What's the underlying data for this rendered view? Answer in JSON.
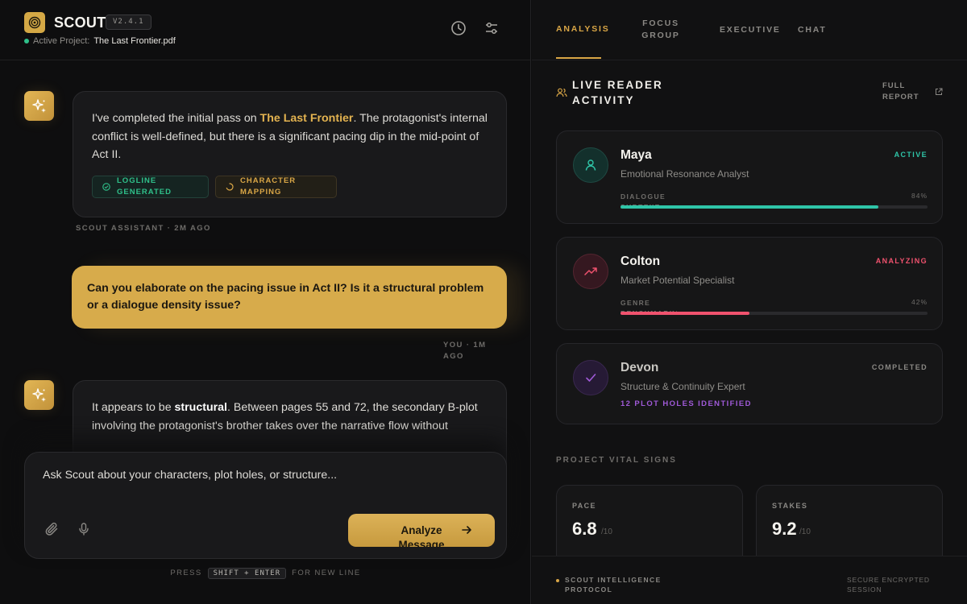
{
  "header": {
    "app_name": "SCOUT",
    "version": "V2.4.1",
    "project_label": "Active Project:",
    "project_name": "The Last Frontier.pdf",
    "icons": [
      "history-icon",
      "filter-icon"
    ]
  },
  "chat": {
    "messages": [
      {
        "role": "assistant",
        "text_before": "I've completed the initial pass on ",
        "highlight": "The Last Frontier",
        "text_after": ". The protagonist's internal conflict is well-defined, but there is a significant pacing dip in the mid-point of Act II.",
        "chips": [
          {
            "label": "LOGLINE GENERATED",
            "status": "done",
            "color": "#2fc08a"
          },
          {
            "label": "CHARACTER MAPPING",
            "status": "in-progress",
            "color": "#d9a646"
          }
        ],
        "meta": "SCOUT ASSISTANT · 2M AGO"
      },
      {
        "role": "user",
        "text": "Can you elaborate on the pacing issue in Act II? Is it a structural problem or a dialogue density issue?",
        "meta": "YOU · 1M AGO"
      },
      {
        "role": "assistant",
        "text_before": "It appears to be ",
        "bold": "structural",
        "text_after": ". Between pages 55 and 72, the secondary B-plot involving the protagonist's brother takes over the narrative flow without"
      }
    ]
  },
  "composer": {
    "placeholder": "Ask Scout about your characters, plot holes, or structure...",
    "analyze_label": "Analyze Message",
    "hint_before": "PRESS",
    "hint_key": "SHIFT + ENTER",
    "hint_after": "FOR NEW LINE"
  },
  "tabs": [
    {
      "label": "ANALYSIS",
      "active": true
    },
    {
      "label": "FOCUS GROUP",
      "active": false
    },
    {
      "label": "EXECUTIVE",
      "active": false
    },
    {
      "label": "CHAT",
      "active": false
    }
  ],
  "readers": {
    "title": "LIVE READER ACTIVITY",
    "full_report": "FULL REPORT",
    "items": [
      {
        "name": "Maya",
        "role": "Emotional Resonance Analyst",
        "status": "ACTIVE",
        "status_color": "#2fc5a8",
        "metric": "DIALOGUE SUBTEXT",
        "value_text": "84%",
        "progress": 0.84,
        "icon": "user-icon"
      },
      {
        "name": "Colton",
        "role": "Market Potential Specialist",
        "status": "ANALYZING",
        "status_color": "#f0526e",
        "metric": "GENRE BENCHMARKS",
        "value_text": "42%",
        "progress": 0.42,
        "icon": "trending-up-icon"
      },
      {
        "name": "Devon",
        "role": "Structure & Continuity Expert",
        "status": "COMPLETED",
        "status_color": "#8a8884",
        "result": "12 PLOT HOLES IDENTIFIED",
        "icon": "check-icon"
      }
    ]
  },
  "vitals": {
    "title": "PROJECT VITAL SIGNS",
    "items": [
      {
        "label": "PACE",
        "value": "6.8",
        "max": "/10"
      },
      {
        "label": "STAKES",
        "value": "9.2",
        "max": "/10"
      }
    ]
  },
  "footer": {
    "left": "SCOUT INTELLIGENCE PROTOCOL",
    "right": "SECURE ENCRYPTED SESSION"
  }
}
